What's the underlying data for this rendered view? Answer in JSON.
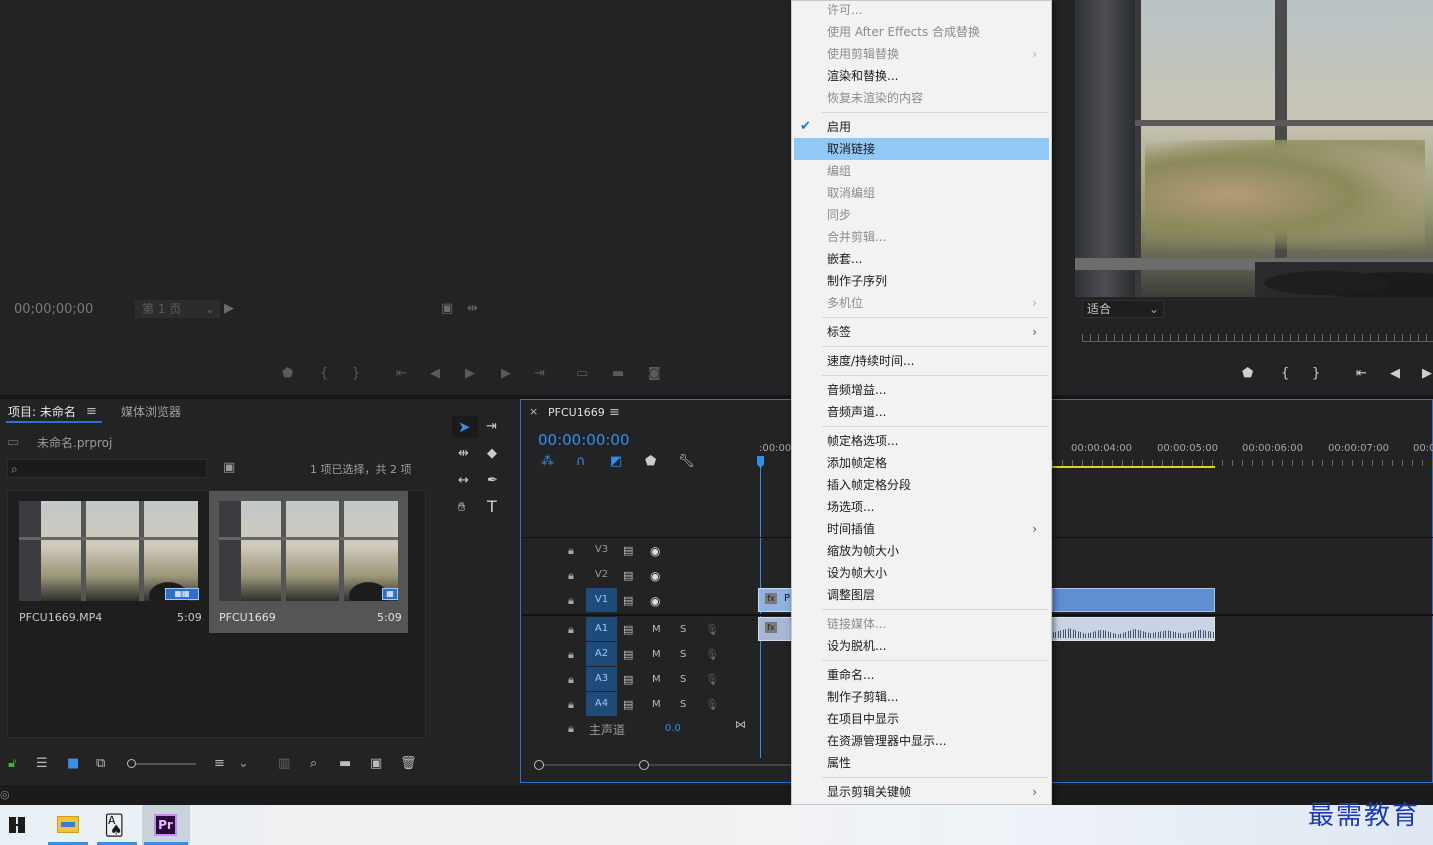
{
  "source_monitor": {
    "timecode": "00;00;00;00",
    "page_select": "第 1 页"
  },
  "program_monitor": {
    "fit_select": "适合"
  },
  "project_panel": {
    "tab_project": "项目: 未命名",
    "tab_media": "媒体浏览器",
    "project_file": "未命名.prproj",
    "selection_info": "1 项已选择，共 2 项",
    "items": [
      {
        "name": "PFCU1669.MP4",
        "duration": "5:09"
      },
      {
        "name": "PFCU1669",
        "duration": "5:09"
      }
    ]
  },
  "timeline": {
    "tab_name": "PFCU1669",
    "timecode": "00:00:00:00",
    "ruler_labels": [
      ":00:00",
      "00:00:04:00",
      "00:00:05:00",
      "00:00:06:00",
      "00:00:07:00",
      "00:0"
    ],
    "video_tracks": [
      "V3",
      "V2",
      "V1"
    ],
    "audio_tracks": [
      "A1",
      "A2",
      "A3",
      "A4"
    ],
    "mix_letters": [
      "M",
      "S"
    ],
    "master_label": "主声道",
    "master_value": "0.0",
    "clip_label": "P"
  },
  "context_menu": {
    "items": [
      {
        "label": "许可...",
        "disabled": true
      },
      {
        "label": "使用 After Effects 合成替换",
        "disabled": true
      },
      {
        "label": "使用剪辑替换",
        "disabled": true,
        "submenu": true
      },
      {
        "label": "渲染和替换...",
        "disabled": false
      },
      {
        "label": "恢复未渲染的内容",
        "disabled": true
      },
      {
        "label": "启用",
        "disabled": false,
        "checked": true
      },
      {
        "label": "取消链接",
        "disabled": false,
        "highlighted": true
      },
      {
        "label": "编组",
        "disabled": true
      },
      {
        "label": "取消编组",
        "disabled": true
      },
      {
        "label": "同步",
        "disabled": true
      },
      {
        "label": "合并剪辑...",
        "disabled": true
      },
      {
        "label": "嵌套...",
        "disabled": false
      },
      {
        "label": "制作子序列",
        "disabled": false
      },
      {
        "label": "多机位",
        "disabled": true,
        "submenu": true
      },
      {
        "label": "标签",
        "disabled": false,
        "submenu": true
      },
      {
        "label": "速度/持续时间...",
        "disabled": false
      },
      {
        "label": "音频增益...",
        "disabled": false
      },
      {
        "label": "音频声道...",
        "disabled": false
      },
      {
        "label": "帧定格选项...",
        "disabled": false
      },
      {
        "label": "添加帧定格",
        "disabled": false
      },
      {
        "label": "插入帧定格分段",
        "disabled": false
      },
      {
        "label": "场选项...",
        "disabled": false
      },
      {
        "label": "时间插值",
        "disabled": false,
        "submenu": true
      },
      {
        "label": "缩放为帧大小",
        "disabled": false
      },
      {
        "label": "设为帧大小",
        "disabled": false
      },
      {
        "label": "调整图层",
        "disabled": false
      },
      {
        "label": "链接媒体...",
        "disabled": true
      },
      {
        "label": "设为脱机...",
        "disabled": false
      },
      {
        "label": "重命名...",
        "disabled": false
      },
      {
        "label": "制作子剪辑...",
        "disabled": false
      },
      {
        "label": "在项目中显示",
        "disabled": false
      },
      {
        "label": "在资源管理器中显示...",
        "disabled": false
      },
      {
        "label": "属性",
        "disabled": false
      },
      {
        "label": "显示剪辑关键帧",
        "disabled": false,
        "submenu": true
      }
    ]
  },
  "watermark": "最需教育",
  "taskbar": {
    "premiere_label": "Pr"
  }
}
